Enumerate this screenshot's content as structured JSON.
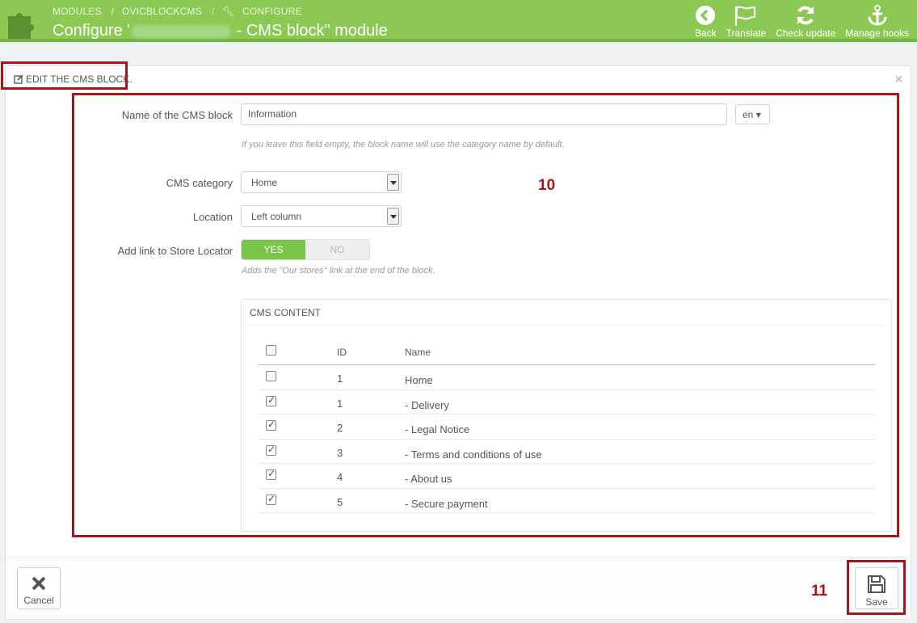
{
  "header": {
    "breadcrumbs": [
      "MODULES",
      "OVICBLOCKCMS",
      "CONFIGURE"
    ],
    "title_prefix": "Configure '",
    "title_suffix": " - CMS block\" module",
    "toolbar": [
      {
        "label": "Back",
        "icon": "back-circle-icon"
      },
      {
        "label": "Translate",
        "icon": "flag-icon"
      },
      {
        "label": "Check update",
        "icon": "refresh-icon"
      },
      {
        "label": "Manage hooks",
        "icon": "anchor-icon"
      }
    ],
    "accent_color": "#8bc954"
  },
  "panel": {
    "heading": "EDIT THE CMS BLOCK.",
    "close": "×"
  },
  "form": {
    "name_label": "Name of the CMS block",
    "name_value": "Information",
    "lang_value": "en",
    "name_help": "If you leave this field empty, the block name will use the category name by default.",
    "category_label": "CMS category",
    "category_value": "Home",
    "location_label": "Location",
    "location_value": "Left column",
    "store_label": "Add link to Store Locator",
    "store_yes": "YES",
    "store_no": "NO",
    "store_value": "YES",
    "store_help": "Adds the \"Our stores\" link at the end of the block."
  },
  "cms_content": {
    "heading": "CMS CONTENT",
    "columns": [
      "ID",
      "Name"
    ],
    "rows": [
      {
        "id": "1",
        "name": "Home",
        "checked": false
      },
      {
        "id": "1",
        "name": "- Delivery",
        "checked": true
      },
      {
        "id": "2",
        "name": "- Legal Notice",
        "checked": true
      },
      {
        "id": "3",
        "name": "- Terms and conditions of use",
        "checked": true
      },
      {
        "id": "4",
        "name": "- About us",
        "checked": true
      },
      {
        "id": "5",
        "name": "- Secure payment",
        "checked": true
      }
    ]
  },
  "footer": {
    "cancel_label": "Cancel",
    "save_label": "Save"
  },
  "annotations": {
    "a10": "10",
    "a11": "11",
    "color": "#a8141c"
  }
}
